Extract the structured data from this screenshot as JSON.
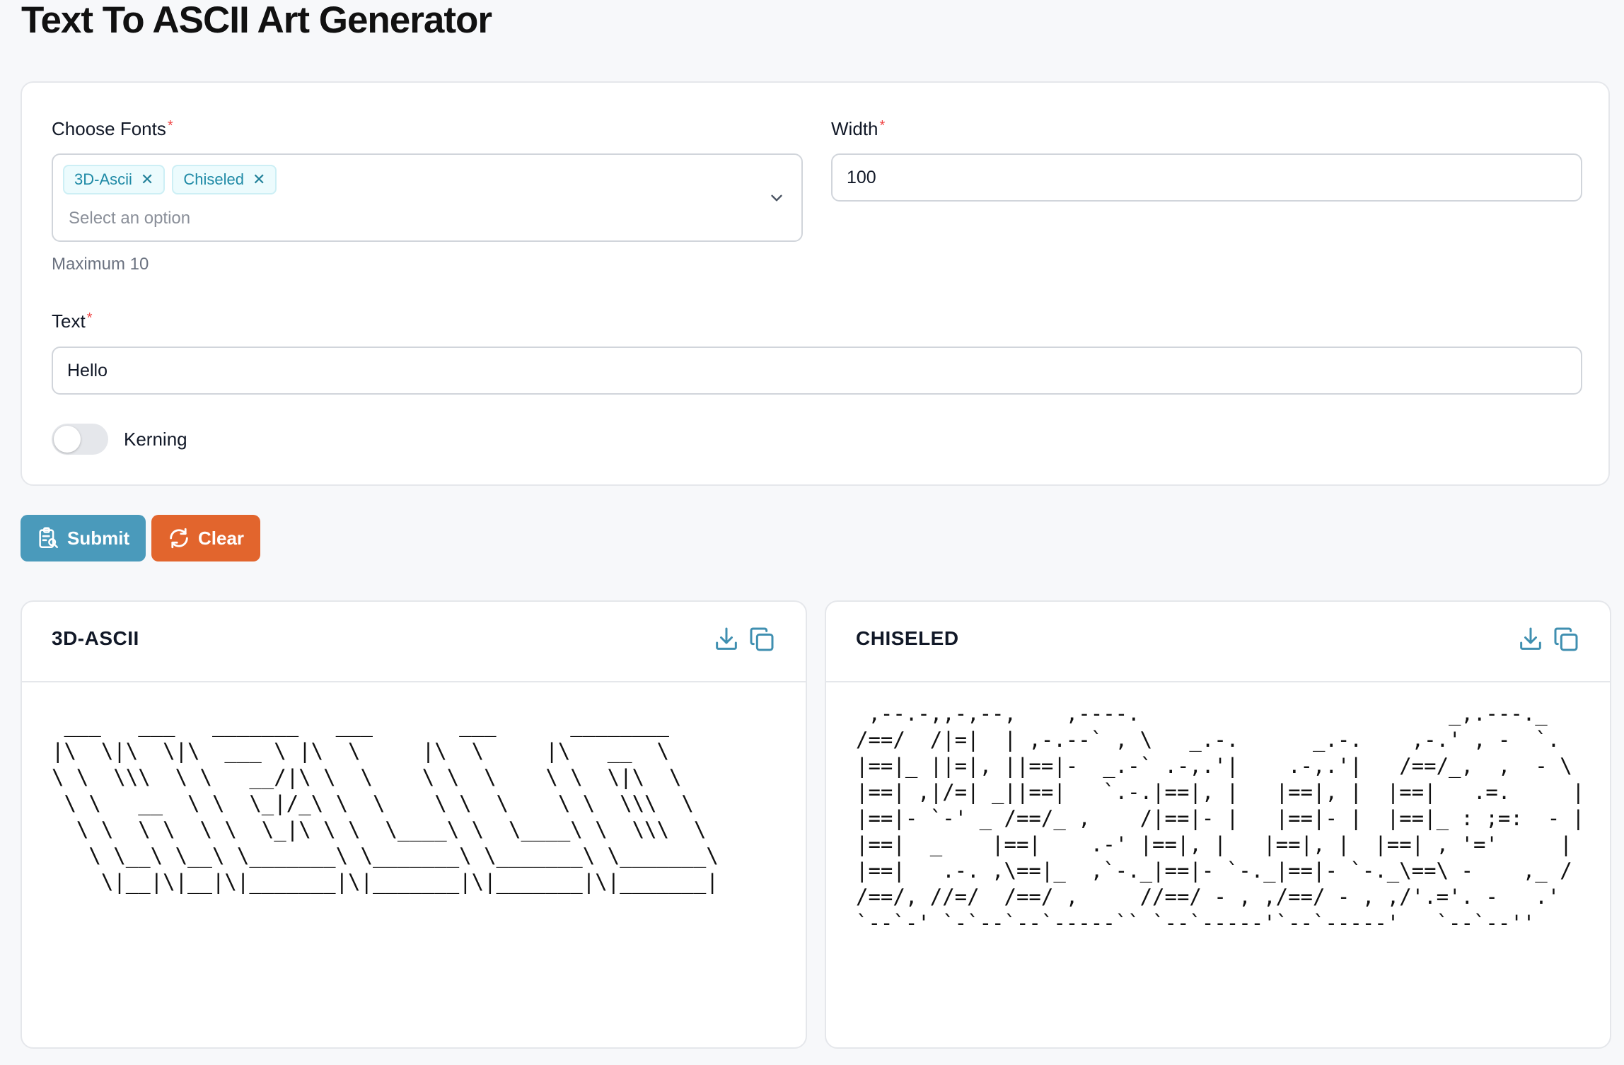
{
  "page": {
    "title": "Text To ASCII Art Generator"
  },
  "form": {
    "fonts": {
      "label": "Choose Fonts",
      "required_mark": "*",
      "selected": [
        "3D-Ascii",
        "Chiseled"
      ],
      "placeholder": "Select an option",
      "hint": "Maximum 10"
    },
    "width": {
      "label": "Width",
      "required_mark": "*",
      "value": "100"
    },
    "text": {
      "label": "Text",
      "required_mark": "*",
      "value": "Hello"
    },
    "kerning": {
      "label": "Kerning",
      "enabled": false
    }
  },
  "actions": {
    "submit_label": "Submit",
    "clear_label": "Clear"
  },
  "colors": {
    "accent": "#4a9abb",
    "clear": "#e2652d",
    "icon": "#3f8fb0"
  },
  "results": [
    {
      "title": "3D-ASCII",
      "art": " ___   ___   _______   ___       ___      ________\n|\\  \\|\\  \\|\\  ___ \\ |\\  \\     |\\  \\     |\\   __  \\\n\\ \\  \\\\\\  \\ \\   __/|\\ \\  \\    \\ \\  \\    \\ \\  \\|\\  \\\n \\ \\   __  \\ \\  \\_|/_\\ \\  \\    \\ \\  \\    \\ \\  \\\\\\  \\\n  \\ \\  \\ \\  \\ \\  \\_|\\ \\ \\  \\____\\ \\  \\____\\ \\  \\\\\\  \\\n   \\ \\__\\ \\__\\ \\_______\\ \\_______\\ \\_______\\ \\_______\\\n    \\|__|\\|__|\\|_______|\\|_______|\\|_______|\\|_______|"
    },
    {
      "title": "CHISELED",
      "art": " ,--.-,,-,--,    ,----.                         _,.---._\n/==/  /|=|  | ,-.--` , \\   _.-.      _.-.    ,-.' , -  `.\n|==|_ ||=|, ||==|-  _.-` .-,.'|    .-,.'|   /==/_,  ,  - \\\n|==| ,|/=| _||==|   `.-.|==|, |   |==|, |  |==|   .=.     |\n|==|- `-' _ /==/_ ,    /|==|- |   |==|- |  |==|_ : ;=:  - |\n|==|  _    |==|    .-' |==|, |   |==|, |  |==| , '='     |\n|==|   .-. ,\\==|_  ,`-._|==|- `-._|==|- `-._\\==\\ -    ,_ /\n/==/, //=/  /==/ ,     //==/ - , ,/==/ - , ,/'.='. -   .'\n`--`-' `-`--`--`-----`` `--`-----'`--`-----'   `--`--''"
    }
  ]
}
